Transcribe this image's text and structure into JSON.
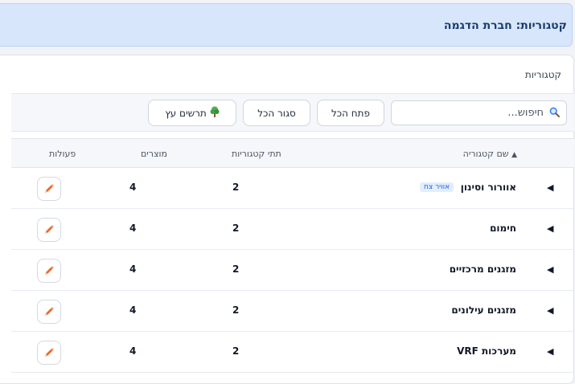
{
  "header": {
    "title": "קטגוריות: חברת הדגמה"
  },
  "section": {
    "title": "קטגוריות"
  },
  "toolbar": {
    "search_placeholder": "חיפוש...",
    "expand_all": "פתח הכל",
    "collapse_all": "סגור הכל",
    "tree_chart": "תרשים עץ"
  },
  "table": {
    "columns": {
      "name": "שם קטגוריה",
      "sort_indicator": "▲",
      "subcategories": "תתי קטגוריות",
      "products": "מוצרים",
      "actions": "פעולות"
    },
    "rows": [
      {
        "name": "אוורור וסינון",
        "badge": "אוויר צח",
        "subcategories": "2",
        "products": "4"
      },
      {
        "name": "חימום",
        "badge": "",
        "subcategories": "2",
        "products": "4"
      },
      {
        "name": "מזגנים מרכזיים",
        "badge": "",
        "subcategories": "2",
        "products": "4"
      },
      {
        "name": "מזגנים עילונים",
        "badge": "",
        "subcategories": "2",
        "products": "4"
      },
      {
        "name": "מערכות VRF",
        "badge": "",
        "subcategories": "2",
        "products": "4"
      }
    ]
  },
  "icons": {
    "expand_caret": "◀",
    "search": "search-icon",
    "tree": "tree-icon",
    "edit": "pencil-icon"
  },
  "colors": {
    "header_bg": "#d7e6fb",
    "badge_text": "#2563eb",
    "pencil": "#ea6b2c"
  }
}
